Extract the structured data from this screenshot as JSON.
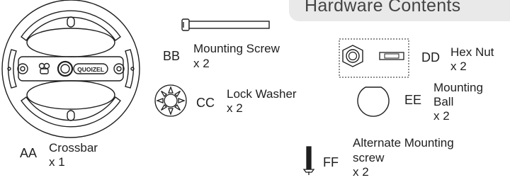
{
  "header": {
    "title": "Hardware Contents"
  },
  "parts": {
    "aa": {
      "code": "AA",
      "name": "Crossbar",
      "qty": "x 1",
      "brand": "QUOIZEL"
    },
    "bb": {
      "code": "BB",
      "name": "Mounting Screw",
      "qty": "x 2"
    },
    "cc": {
      "code": "CC",
      "name": "Lock Washer",
      "qty": "x 2"
    },
    "dd": {
      "code": "DD",
      "name": "Hex Nut",
      "qty": "x 2"
    },
    "ee": {
      "code": "EE",
      "name_line1": "Mounting",
      "name_line2": "Ball",
      "qty": "x 2"
    },
    "ff": {
      "code": "FF",
      "name_line1": "Alternate Mounting",
      "name_line2": "screw",
      "qty": "x 2"
    }
  },
  "colors": {
    "ink": "#1f1f1f",
    "header_bg": "#e9e9e9",
    "header_text": "#444444"
  },
  "icons": [
    "crossbar-icon",
    "mounting-screw-icon",
    "lock-washer-icon",
    "hex-nut-icon",
    "mounting-ball-icon",
    "alternate-screw-icon"
  ]
}
